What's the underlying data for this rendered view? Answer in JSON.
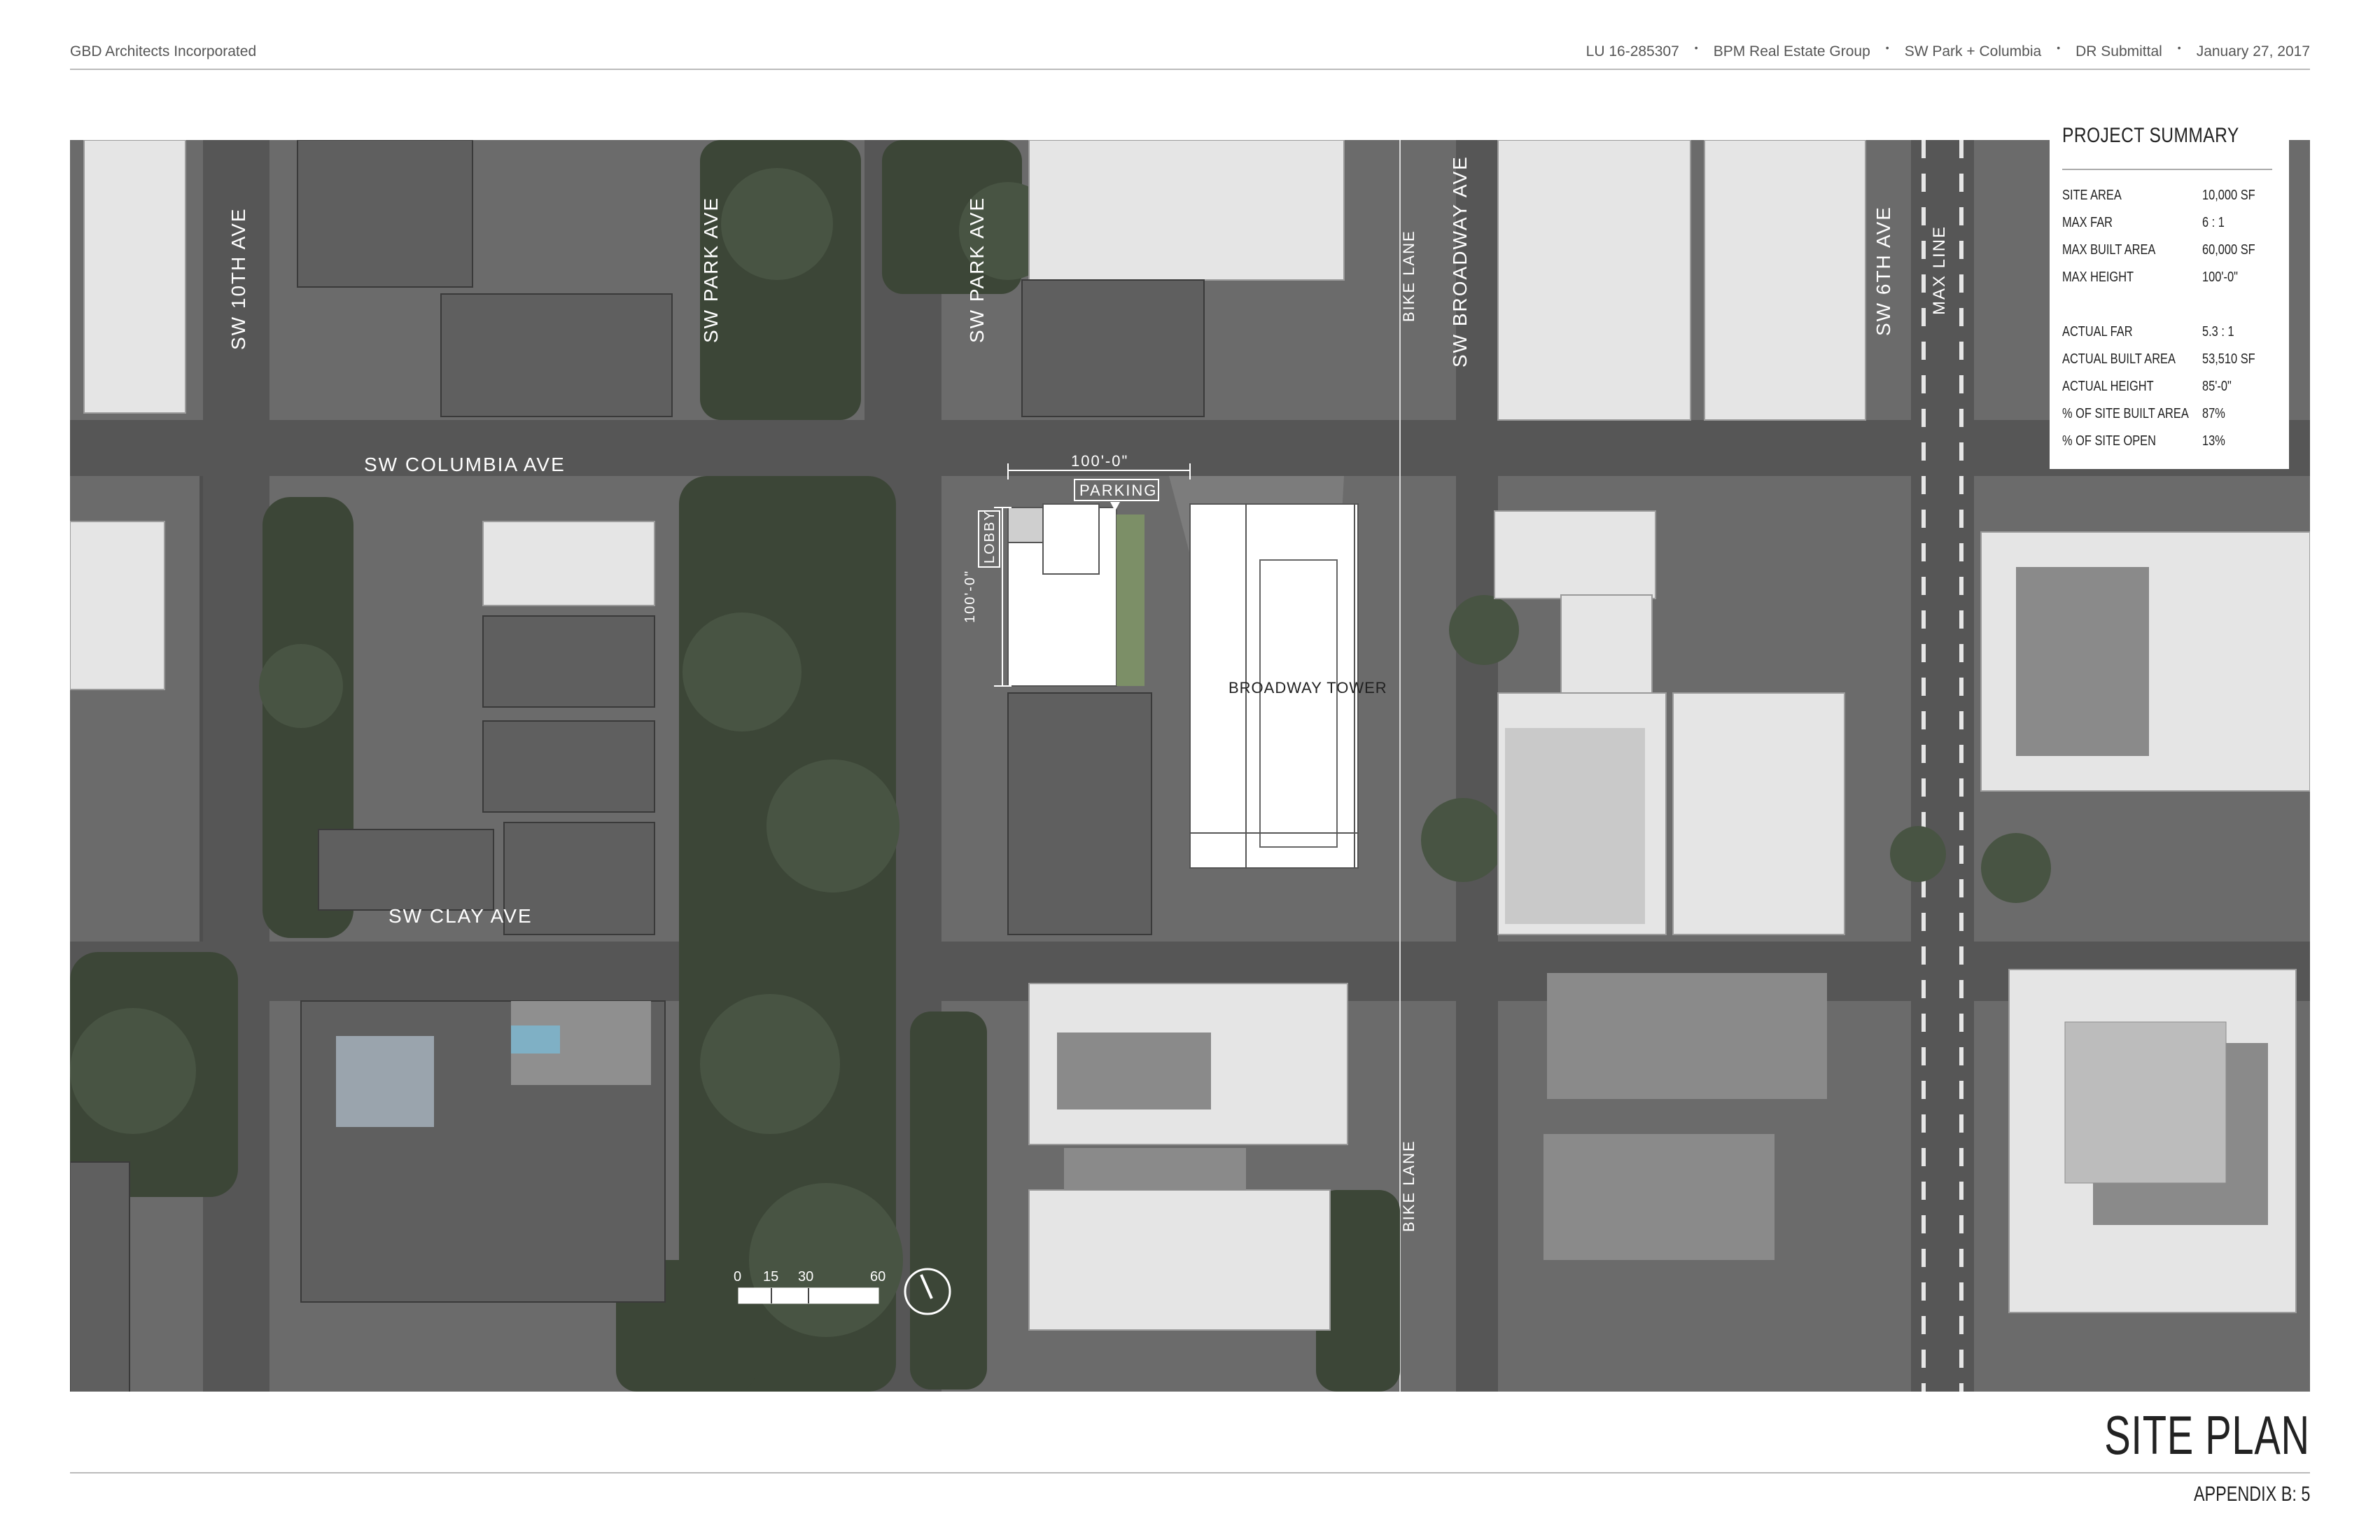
{
  "header": {
    "left": "GBD Architects Incorporated",
    "right_items": [
      "LU 16-285307",
      "BPM Real Estate Group",
      "SW Park + Columbia",
      "DR Submittal",
      "January 27, 2017"
    ],
    "separator": "•"
  },
  "map": {
    "streets": {
      "sw_10th": "SW 10TH AVE",
      "sw_park_1": "SW PARK AVE",
      "sw_park_2": "SW PARK AVE",
      "sw_broadway": "SW BROADWAY AVE",
      "sw_6th": "SW 6TH AVE",
      "max_line": "MAX LINE",
      "sw_columbia": "SW COLUMBIA AVE",
      "sw_clay": "SW CLAY AVE",
      "bike_lane_1": "BIKE LANE",
      "bike_lane_2": "BIKE LANE"
    },
    "site": {
      "dim_width": "100'-0\"",
      "dim_depth": "100'-0\"",
      "parking": "PARKING",
      "lobby": "LOBBY",
      "building": "BROADWAY TOWER"
    },
    "scale": {
      "labels": [
        "0",
        "15",
        "30",
        "60"
      ]
    },
    "north_arrow": "north-arrow-icon"
  },
  "project_summary": {
    "title": "PROJECT SUMMARY",
    "rows": [
      {
        "label": "SITE AREA",
        "value": "10,000 SF"
      },
      {
        "label": "MAX FAR",
        "value": "6 : 1"
      },
      {
        "label": "MAX BUILT AREA",
        "value": "60,000 SF"
      },
      {
        "label": "MAX HEIGHT",
        "value": "100'-0\""
      },
      {
        "label": "ACTUAL FAR",
        "value": "5.3 : 1"
      },
      {
        "label": "ACTUAL BUILT AREA",
        "value": "53,510 SF"
      },
      {
        "label": "ACTUAL HEIGHT",
        "value": "85'-0\""
      },
      {
        "label": "% OF SITE BUILT AREA",
        "value": "87%"
      },
      {
        "label": "% OF SITE OPEN",
        "value": "13%"
      }
    ]
  },
  "footer": {
    "title": "SITE PLAN",
    "subtitle": "APPENDIX B: 5"
  },
  "colors": {
    "road": "#5a5a5a",
    "tree": "#3f4a39",
    "roof_light": "#e8e8e8",
    "roof_dark": "#707070",
    "proposed": "#ffffff"
  }
}
